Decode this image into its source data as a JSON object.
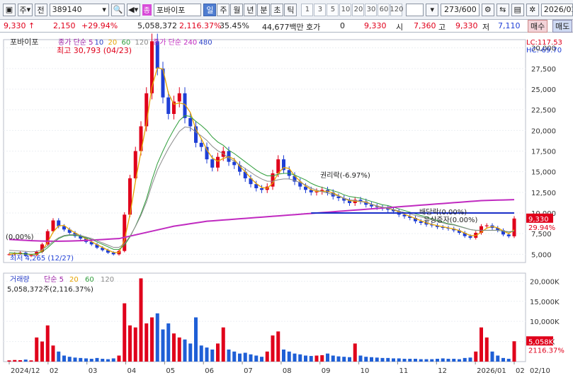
{
  "toolbar": {
    "market": "주",
    "period_btn": "전",
    "code": "389140",
    "badge": "종",
    "name": "포바이포",
    "tabs": [
      "일",
      "주",
      "월",
      "년",
      "분",
      "초",
      "틱"
    ],
    "active_tab": "일",
    "nums": [
      "1",
      "3",
      "5",
      "10",
      "20",
      "30",
      "60",
      "120"
    ],
    "count": "273",
    "count_total": "/600",
    "date": "2026/02/"
  },
  "quote": {
    "price": "9,330",
    "arrow": "↑",
    "change": "2,150",
    "change_pct": "+29.94%",
    "volume": "5,058,372",
    "vol_pct": "2,116.37%",
    "turnover_pct": "35.45%",
    "amount": "44,677백만",
    "hoga_label": "호가",
    "hoga_val": "0",
    "cur": "9,330",
    "open_label": "시",
    "open": "7,360",
    "high_label": "고",
    "high": "9,330",
    "low_label": "저",
    "low": "7,110",
    "buy_btn": "매수",
    "sell_btn": "매도"
  },
  "colors": {
    "up": "#e0001b",
    "down": "#1f3fd6",
    "ma5": "#9b1ea5",
    "ma10": "#2a40c8",
    "ma20": "#e6a300",
    "ma60": "#2e9d3a",
    "ma120": "#8a8a8a",
    "ma240": "#c02ac0",
    "vol_up": "#e0001b",
    "vol_down": "#1f5fd6"
  },
  "chart_data": [
    {
      "type": "line",
      "title": "포바이포",
      "legend": [
        "종가 단순 5",
        "10",
        "20",
        "60",
        "120",
        "종가 단순 240",
        "480"
      ],
      "x_ticks": [
        "2024/12",
        "02",
        "03",
        "04",
        "05",
        "06",
        "07",
        "08",
        "09",
        "10",
        "11",
        "12",
        "2026/01",
        "02",
        "02/10"
      ],
      "ylim": [
        4000,
        31000
      ],
      "y_ticks": [
        "5,000",
        "7,500",
        "10,000",
        "12,500",
        "15,000",
        "17,500",
        "20,000",
        "22,500",
        "25,000",
        "27,500",
        "30,000"
      ],
      "annotations": {
        "high": "최고 30,793 (04/23)",
        "low": "최저 4,265 (12/27)",
        "left_pct": "(0,00%)",
        "rights": "권리락(-6.97%)",
        "dividend": "배당락(0.00%)",
        "capital": "유상증자(0.00%)",
        "lc": "LC:117.53",
        "hc": "HC:-69.70",
        "cur_price": "9,330",
        "cur_pct": "29.94%"
      },
      "series": [
        {
          "name": "종가",
          "values": [
            5000,
            5100,
            5200,
            4800,
            4900,
            5300,
            6200,
            7800,
            9100,
            8400,
            8000,
            7600,
            7200,
            6900,
            6500,
            6200,
            5800,
            5500,
            5200,
            5000,
            5400,
            9800,
            14200,
            17500,
            20500,
            24500,
            30800,
            27500,
            24000,
            22000,
            23500,
            24500,
            21500,
            20500,
            18500,
            18000,
            16500,
            15500,
            16800,
            17500,
            16200,
            15800,
            15000,
            14200,
            13500,
            13000,
            12800,
            13200,
            14800,
            16500,
            15200,
            14500,
            13800,
            13200,
            12800,
            12500,
            12600,
            12800,
            12500,
            12000,
            11800,
            11500,
            11200,
            11600,
            11400,
            11000,
            10800,
            10700,
            10600,
            10400,
            10200,
            9800,
            9600,
            9400,
            9000,
            8800,
            8600,
            8500,
            8300,
            8200,
            8100,
            7900,
            7600,
            7200,
            7000,
            7600,
            8400,
            8500,
            8200,
            7900,
            7400,
            7180,
            9330
          ]
        },
        {
          "name": "단순 20",
          "values": [
            5200,
            5150,
            5100,
            5050,
            5000,
            5050,
            5300,
            5800,
            6400,
            6900,
            7200,
            7300,
            7300,
            7200,
            7000,
            6800,
            6500,
            6200,
            5900,
            5600,
            5600,
            6100,
            7100,
            8400,
            9900,
            11700,
            14000,
            16000,
            17500,
            18900,
            20100,
            21200,
            21800,
            21700,
            21100,
            20600,
            20000,
            19200,
            18600,
            18200,
            17600,
            17200,
            16700,
            16200,
            15700,
            15200,
            14800,
            14500,
            14500,
            14700,
            14800,
            14800,
            14600,
            14300,
            14000,
            13600,
            13300,
            13100,
            12900,
            12700,
            12500,
            12200,
            12000,
            11900,
            11800,
            11600,
            11400,
            11200,
            11000,
            10900,
            10700,
            10500,
            10300,
            10100,
            9900,
            9700,
            9500,
            9300,
            9100,
            8900,
            8700,
            8600,
            8400,
            8200,
            8000,
            7900,
            7900,
            7900,
            7900,
            7900,
            7800,
            7700,
            7800
          ]
        },
        {
          "name": "단순 240",
          "values": [
            6800,
            6760,
            6720,
            6690,
            6650,
            6620,
            6600,
            6590,
            6580,
            6580,
            6590,
            6600,
            6620,
            6650,
            6680,
            6710,
            6750,
            6790,
            6830,
            6870,
            6900,
            7050,
            7200,
            7350,
            7500,
            7650,
            7800,
            7950,
            8100,
            8250,
            8400,
            8500,
            8600,
            8700,
            8800,
            8900,
            9000,
            9050,
            9100,
            9150,
            9200,
            9250,
            9300,
            9350,
            9400,
            9450,
            9500,
            9550,
            9600,
            9650,
            9700,
            9750,
            9800,
            9850,
            9900,
            9950,
            10000,
            10050,
            10100,
            10150,
            10200,
            10250,
            10300,
            10350,
            10400,
            10450,
            10500,
            10550,
            10600,
            10650,
            10700,
            10750,
            10800,
            10850,
            10900,
            10950,
            11000,
            11050,
            11100,
            11150,
            11200,
            11250,
            11300,
            11350,
            11400,
            11450,
            11500,
            11520,
            11540,
            11560,
            11580,
            11600,
            11620
          ]
        }
      ]
    },
    {
      "type": "bar",
      "title": "거래량",
      "legend": [
        "단순 5",
        "20",
        "60",
        "120"
      ],
      "label": "5,058,372주(2,116.37%)",
      "ylim": [
        0,
        22000
      ],
      "y_ticks": [
        "5,000K",
        "10,000K",
        "15,000K",
        "20,000K"
      ],
      "unit": "K",
      "cur_label": "5,058K",
      "cur_pct": "2116.37%",
      "values": [
        300,
        400,
        350,
        500,
        300,
        6000,
        5000,
        9000,
        4000,
        2500,
        1500,
        1200,
        1000,
        900,
        800,
        700,
        900,
        700,
        600,
        800,
        1500,
        14500,
        9000,
        8500,
        20700,
        9500,
        11000,
        12000,
        8000,
        9500,
        7000,
        6000,
        5500,
        4500,
        11000,
        4000,
        3500,
        3000,
        4500,
        8500,
        3000,
        2500,
        2000,
        2200,
        1800,
        1500,
        1200,
        2500,
        6500,
        7500,
        3000,
        2500,
        2000,
        1800,
        1500,
        1400,
        1500,
        1600,
        2000,
        1500,
        1300,
        1200,
        1100,
        4500,
        1500,
        1200,
        1100,
        1000,
        900,
        900,
        800,
        800,
        700,
        700,
        700,
        600,
        600,
        600,
        700,
        800,
        700,
        700,
        600,
        900,
        1000,
        2500,
        8500,
        6000,
        2500,
        1500,
        900,
        700,
        5058
      ]
    }
  ]
}
